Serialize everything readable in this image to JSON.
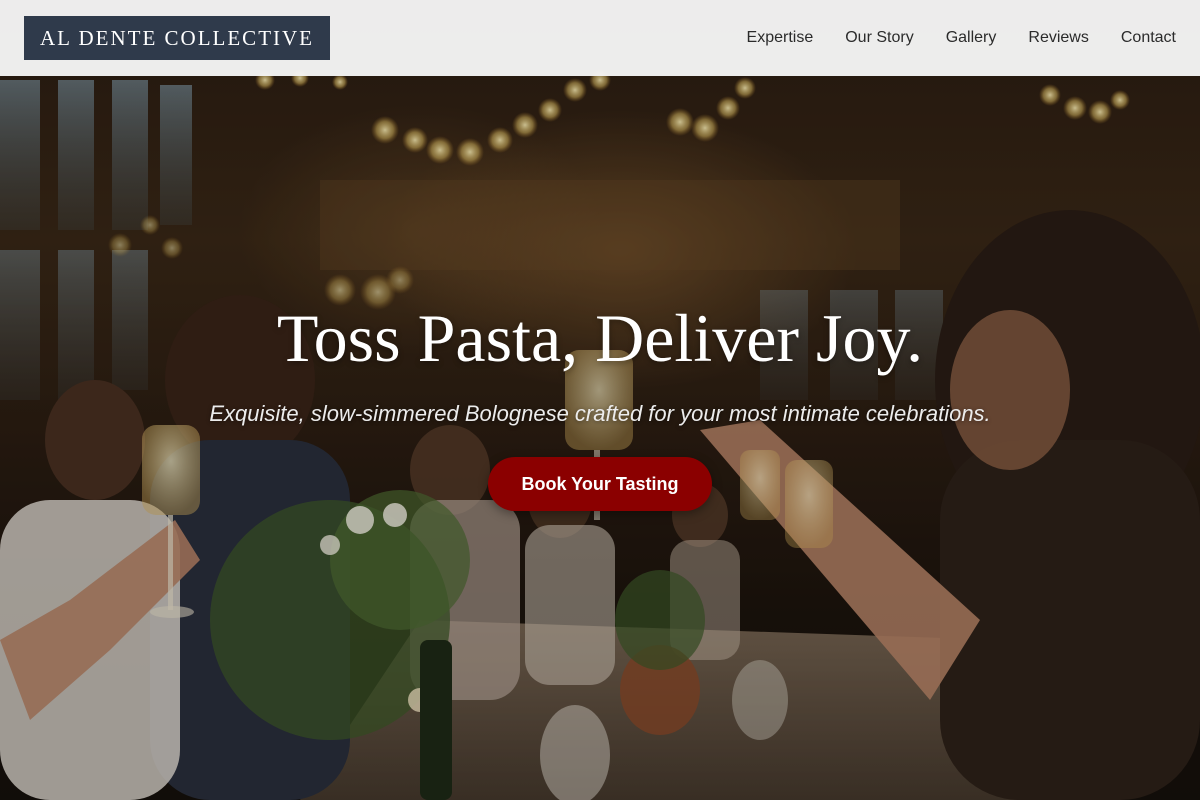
{
  "brand": {
    "name": "AL DENTE COLLECTIVE",
    "colors": {
      "header_bg": "#f6f6f6",
      "logo_bg": "#2f3a4b",
      "cta_bg": "#8b0000",
      "hero_text": "#ffffff"
    }
  },
  "nav": {
    "items": [
      {
        "label": "Expertise"
      },
      {
        "label": "Our Story"
      },
      {
        "label": "Gallery"
      },
      {
        "label": "Reviews"
      },
      {
        "label": "Contact"
      }
    ]
  },
  "hero": {
    "title": "Toss Pasta, Deliver Joy.",
    "subtitle": "Exquisite, slow-simmered Bolognese crafted for your most intimate celebrations.",
    "cta_label": "Book Your Tasting",
    "background_image": "celebration-toast-photo"
  }
}
